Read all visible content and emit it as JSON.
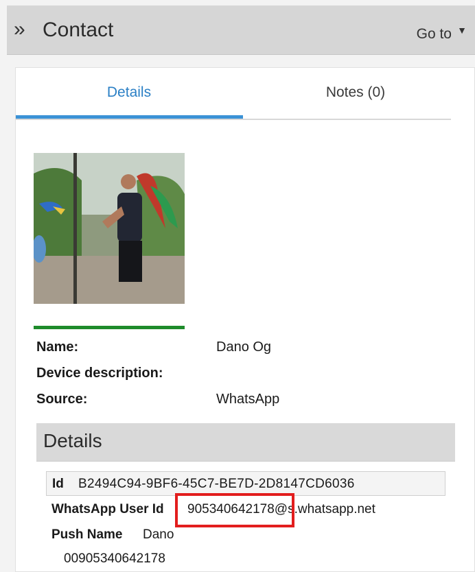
{
  "header": {
    "title": "Contact",
    "goto_label": "Go to"
  },
  "tabs": [
    {
      "label": "Details"
    },
    {
      "label": "Notes (0)"
    }
  ],
  "contact": {
    "name_label": "Name:",
    "name_value": "Dano Og",
    "device_label": "Device description:",
    "device_value": "",
    "source_label": "Source:",
    "source_value": "WhatsApp"
  },
  "details": {
    "section_title": "Details",
    "id_key": "Id",
    "id_value": "B2494C94-9BF6-45C7-BE7D-2D8147CD6036",
    "whatsapp_key": "WhatsApp User Id",
    "whatsapp_value": "905340642178@s.whatsapp.net",
    "pushname_key": "Push Name",
    "pushname_value": "Dano",
    "phone_value": "00905340642178"
  },
  "colors": {
    "accent": "#3b92d6",
    "highlight": "#e21d1d",
    "green_bar": "#1e8b2b"
  }
}
